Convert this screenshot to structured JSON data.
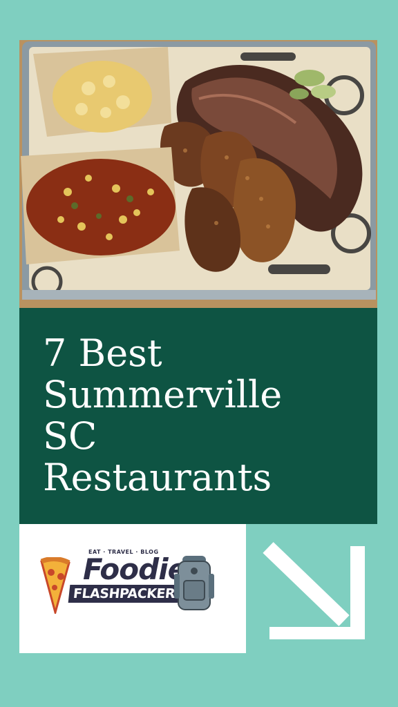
{
  "pin": {
    "title": "7 Best\nSummerville\nSC\nRestaurants"
  },
  "logo": {
    "tagline": "EAT · TRAVEL · BLOG",
    "name_top": "Foodie",
    "name_bottom": "FLASHPACKER"
  },
  "colors": {
    "background": "#7fcfc0",
    "title_panel": "#0e5443",
    "title_text": "#ffffff",
    "logo_navy": "#2e2e48"
  },
  "icons": {
    "arrow": "arrow-down-right-icon",
    "pizza": "pizza-icon",
    "backpack": "backpack-icon"
  }
}
